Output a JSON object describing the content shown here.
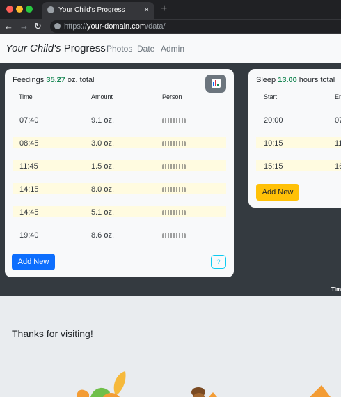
{
  "browser": {
    "tab_title": "Your Child's Progress",
    "url_prefix": "https://",
    "url_host": "your-domain.com",
    "url_path": "/data/",
    "new_tab": "+",
    "close_tab": "×",
    "back": "←",
    "forward": "→",
    "reload": "↻",
    "dot_colors": [
      "#ff5f57",
      "#febc2e",
      "#28c840"
    ]
  },
  "navbar": {
    "brand_italic": "Your Child's",
    "brand_rest": " Progress",
    "links": [
      "Photos",
      "Date",
      "Admin"
    ]
  },
  "feedings": {
    "title": "Feedings",
    "total": "35.27",
    "unit": "oz. total",
    "chart_icon": "chart-icon",
    "columns": [
      "Time",
      "Amount",
      "Person"
    ],
    "rows": [
      {
        "time": "07:40",
        "amount": "9.1 oz."
      },
      {
        "time": "08:45",
        "amount": "3.0 oz."
      },
      {
        "time": "11:45",
        "amount": "1.5 oz."
      },
      {
        "time": "14:15",
        "amount": "8.0 oz."
      },
      {
        "time": "14:45",
        "amount": "5.1 oz."
      },
      {
        "time": "19:40",
        "amount": "8.6 oz."
      }
    ],
    "add_label": "Add New",
    "help_label": "?"
  },
  "sleep": {
    "title": "Sleep",
    "total": "13.00",
    "unit": "hours total",
    "columns": [
      "Start",
      "En"
    ],
    "rows": [
      {
        "start": "20:00",
        "end": "07"
      },
      {
        "start": "10:15",
        "end": "11"
      },
      {
        "start": "15:15",
        "end": "16"
      }
    ],
    "add_label": "Add New"
  },
  "dark_footer": "Tim",
  "thanks": "Thanks for visiting!"
}
